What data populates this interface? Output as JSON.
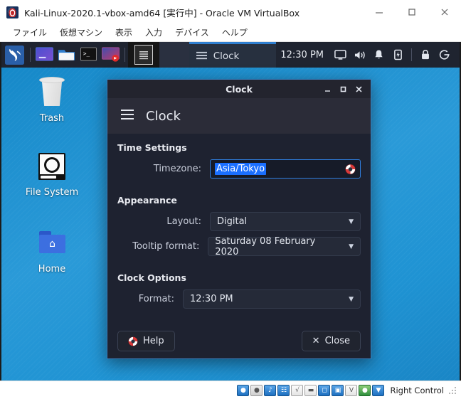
{
  "vbox": {
    "title": "Kali-Linux-2020.1-vbox-amd64 [実行中] - Oracle VM VirtualBox",
    "app_icon": "virtualbox-icon",
    "controls": {
      "minimize": "minimize-icon",
      "maximize": "maximize-icon",
      "close": "close-icon"
    },
    "menus": [
      {
        "label": "ファイル"
      },
      {
        "label": "仮想マシン"
      },
      {
        "label": "表示"
      },
      {
        "label": "入力"
      },
      {
        "label": "デバイス"
      },
      {
        "label": "ヘルプ"
      }
    ],
    "statusbar": {
      "host_key": "Right Control",
      "icons": [
        "harddisk-icon",
        "optical-disk-icon",
        "audio-icon",
        "network-icon",
        "usb-icon",
        "shared-folder-icon",
        "display-icon",
        "video-capture-icon",
        "virtualization-icon",
        "mouse-integration-icon",
        "host-key-icon"
      ]
    }
  },
  "kali_panel": {
    "menu_icon": "kali-dragon-icon",
    "launchers": [
      {
        "name": "terminal-emulator-launcher",
        "icon": "terminal-blue-icon"
      },
      {
        "name": "file-manager-launcher",
        "icon": "folder-icon"
      },
      {
        "name": "root-terminal-launcher",
        "icon": "terminal-black-icon"
      },
      {
        "name": "screen-recorder-launcher",
        "icon": "screen-record-icon"
      }
    ],
    "window_button_icon": "window-list-icon",
    "task": {
      "icon": "clock-window-icon",
      "label": "Clock"
    },
    "tray": {
      "clock": "12:30 PM",
      "icons": [
        {
          "name": "display-settings-icon",
          "glyph": "display-icon"
        },
        {
          "name": "volume-icon",
          "glyph": "speaker-icon"
        },
        {
          "name": "notifications-icon",
          "glyph": "bell-icon"
        },
        {
          "name": "power-manager-icon",
          "glyph": "battery-icon"
        },
        {
          "name": "lock-screen-icon",
          "glyph": "lock-icon"
        },
        {
          "name": "log-out-icon",
          "glyph": "logout-icon"
        }
      ]
    }
  },
  "desktop": {
    "icons": [
      {
        "label": "Trash",
        "icon": "trash-icon"
      },
      {
        "label": "File System",
        "icon": "hard-drive-icon"
      },
      {
        "label": "Home",
        "icon": "home-folder-icon"
      }
    ]
  },
  "dialog": {
    "titlebar": {
      "title": "Clock",
      "minimize": "minimize-icon",
      "maximize": "maximize-icon",
      "close": "close-icon"
    },
    "header": {
      "menu_icon": "hamburger-menu-icon",
      "title": "Clock"
    },
    "sections": {
      "time_settings": {
        "title": "Time Settings",
        "timezone": {
          "label": "Timezone:",
          "value": "Asia/Tokyo",
          "help_icon": "lifebuoy-help-icon"
        }
      },
      "appearance": {
        "title": "Appearance",
        "layout": {
          "label": "Layout:",
          "value": "Digital"
        },
        "tooltip_format": {
          "label": "Tooltip format:",
          "value": "Saturday 08 February 2020"
        }
      },
      "clock_options": {
        "title": "Clock Options",
        "format": {
          "label": "Format:",
          "value": "12:30 PM"
        }
      }
    },
    "buttons": {
      "help": {
        "label": "Help",
        "icon": "lifebuoy-help-icon"
      },
      "close": {
        "label": "Close",
        "icon": "close-x-icon"
      }
    }
  },
  "colors": {
    "accent_blue": "#2f7fd0",
    "selection_blue": "#1a6fff",
    "desktop_blue": "#2a9ad8",
    "panel_dark": "#1f2430",
    "dialog_bg": "#1e2230"
  }
}
